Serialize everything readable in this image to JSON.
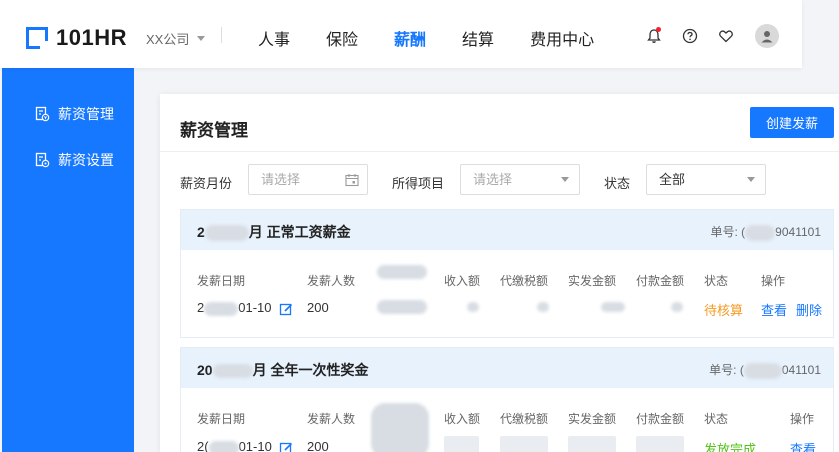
{
  "header": {
    "logo_text": "101HR",
    "company": "XX公司",
    "nav": [
      {
        "label": "人事",
        "active": false
      },
      {
        "label": "保险",
        "active": false
      },
      {
        "label": "薪酬",
        "active": true
      },
      {
        "label": "结算",
        "active": false
      },
      {
        "label": "费用中心",
        "active": false
      }
    ],
    "icons": [
      "bell-icon",
      "help-icon",
      "heart-icon",
      "user-avatar-icon"
    ]
  },
  "sidebar": {
    "items": [
      {
        "label": "薪资管理"
      },
      {
        "label": "薪资设置"
      }
    ]
  },
  "main": {
    "title": "薪资管理",
    "create_button": "创建发薪",
    "filters": {
      "month_label": "薪资月份",
      "month_placeholder": "请选择",
      "income_label": "所得项目",
      "income_placeholder": "请选择",
      "status_label": "状态",
      "status_value": "全部"
    },
    "columns": [
      "发薪日期",
      "发薪人数",
      "收入额",
      "代缴税额",
      "实发金额",
      "付款金额",
      "状态",
      "操作"
    ],
    "cards": [
      {
        "title_prefix": "2",
        "title_suffix": "月 正常工资薪金",
        "no_label": "单号:",
        "no_prefix": "(",
        "no_suffix": "9041101",
        "date_prefix": "2",
        "date_suffix": "01-10",
        "count": "200",
        "status": "待核算",
        "action_view": "查看",
        "action_delete": "删除"
      },
      {
        "title_prefix": "20",
        "title_suffix": "月 全年一次性奖金",
        "no_label": "单号:",
        "no_prefix": "(",
        "no_suffix": "041101",
        "date_prefix": "2(",
        "date_suffix": "01-10",
        "count": "200",
        "status": "发放完成",
        "action_view": "查看"
      }
    ]
  },
  "colors": {
    "primary": "#1677ff",
    "pending": "#f59a23",
    "done": "#52c41a",
    "card_header": "#e8f2fd"
  }
}
